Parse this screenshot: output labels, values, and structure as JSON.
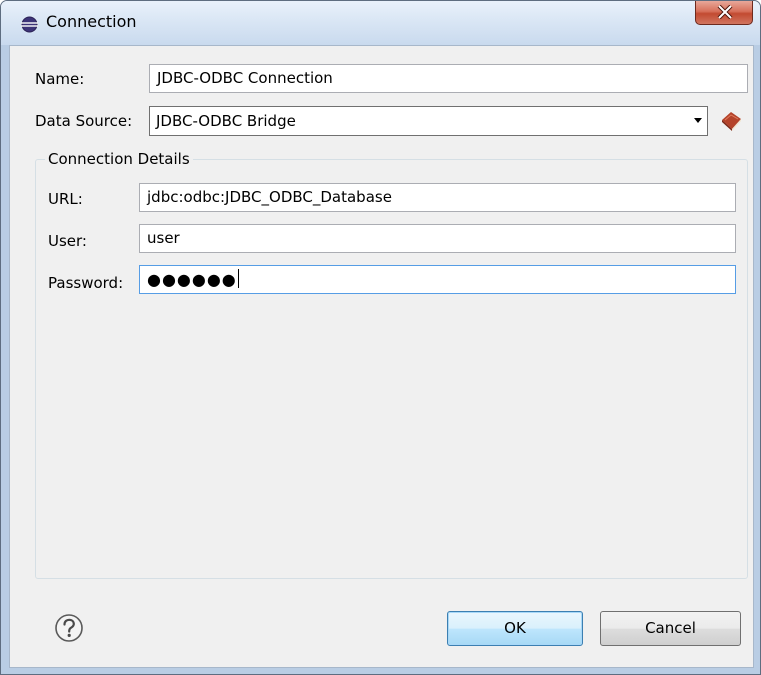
{
  "window": {
    "title": "Connection",
    "close_label": "X"
  },
  "form": {
    "name_label": "Name:",
    "name_value": "JDBC-ODBC Connection",
    "data_source_label": "Data Source:",
    "data_source_value": "JDBC-ODBC Bridge",
    "group_title": "Connection Details",
    "url_label": "URL:",
    "url_value": "jdbc:odbc:JDBC_ODBC_Database",
    "user_label": "User:",
    "user_value": "user",
    "password_label": "Password:",
    "password_value": "●●●●●●"
  },
  "buttons": {
    "ok_label": "OK",
    "cancel_label": "Cancel"
  },
  "icons": {
    "title_icon": "eclipse-icon",
    "book_icon": "book-icon",
    "help_icon": "help-icon"
  },
  "colors": {
    "titlebar": "#d8e5f4",
    "client_bg": "#f0f0f0",
    "close_button": "#c24a31",
    "default_button": "#bee6fd"
  }
}
